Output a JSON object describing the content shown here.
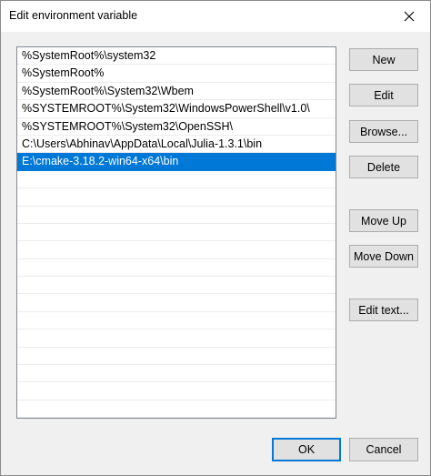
{
  "window": {
    "title": "Edit environment variable"
  },
  "list": {
    "items": [
      "%SystemRoot%\\system32",
      "%SystemRoot%",
      "%SystemRoot%\\System32\\Wbem",
      "%SYSTEMROOT%\\System32\\WindowsPowerShell\\v1.0\\",
      "%SYSTEMROOT%\\System32\\OpenSSH\\",
      "C:\\Users\\Abhinav\\AppData\\Local\\Julia-1.3.1\\bin",
      "E:\\cmake-3.18.2-win64-x64\\bin"
    ],
    "selected_index": 6
  },
  "buttons": {
    "new": "New",
    "edit": "Edit",
    "browse": "Browse...",
    "delete": "Delete",
    "move_up": "Move Up",
    "move_down": "Move Down",
    "edit_text": "Edit text..."
  },
  "footer": {
    "ok": "OK",
    "cancel": "Cancel"
  },
  "colors": {
    "selection": "#0078d7",
    "window_bg": "#f0f0f0"
  },
  "icons": {
    "close": "close-icon"
  }
}
